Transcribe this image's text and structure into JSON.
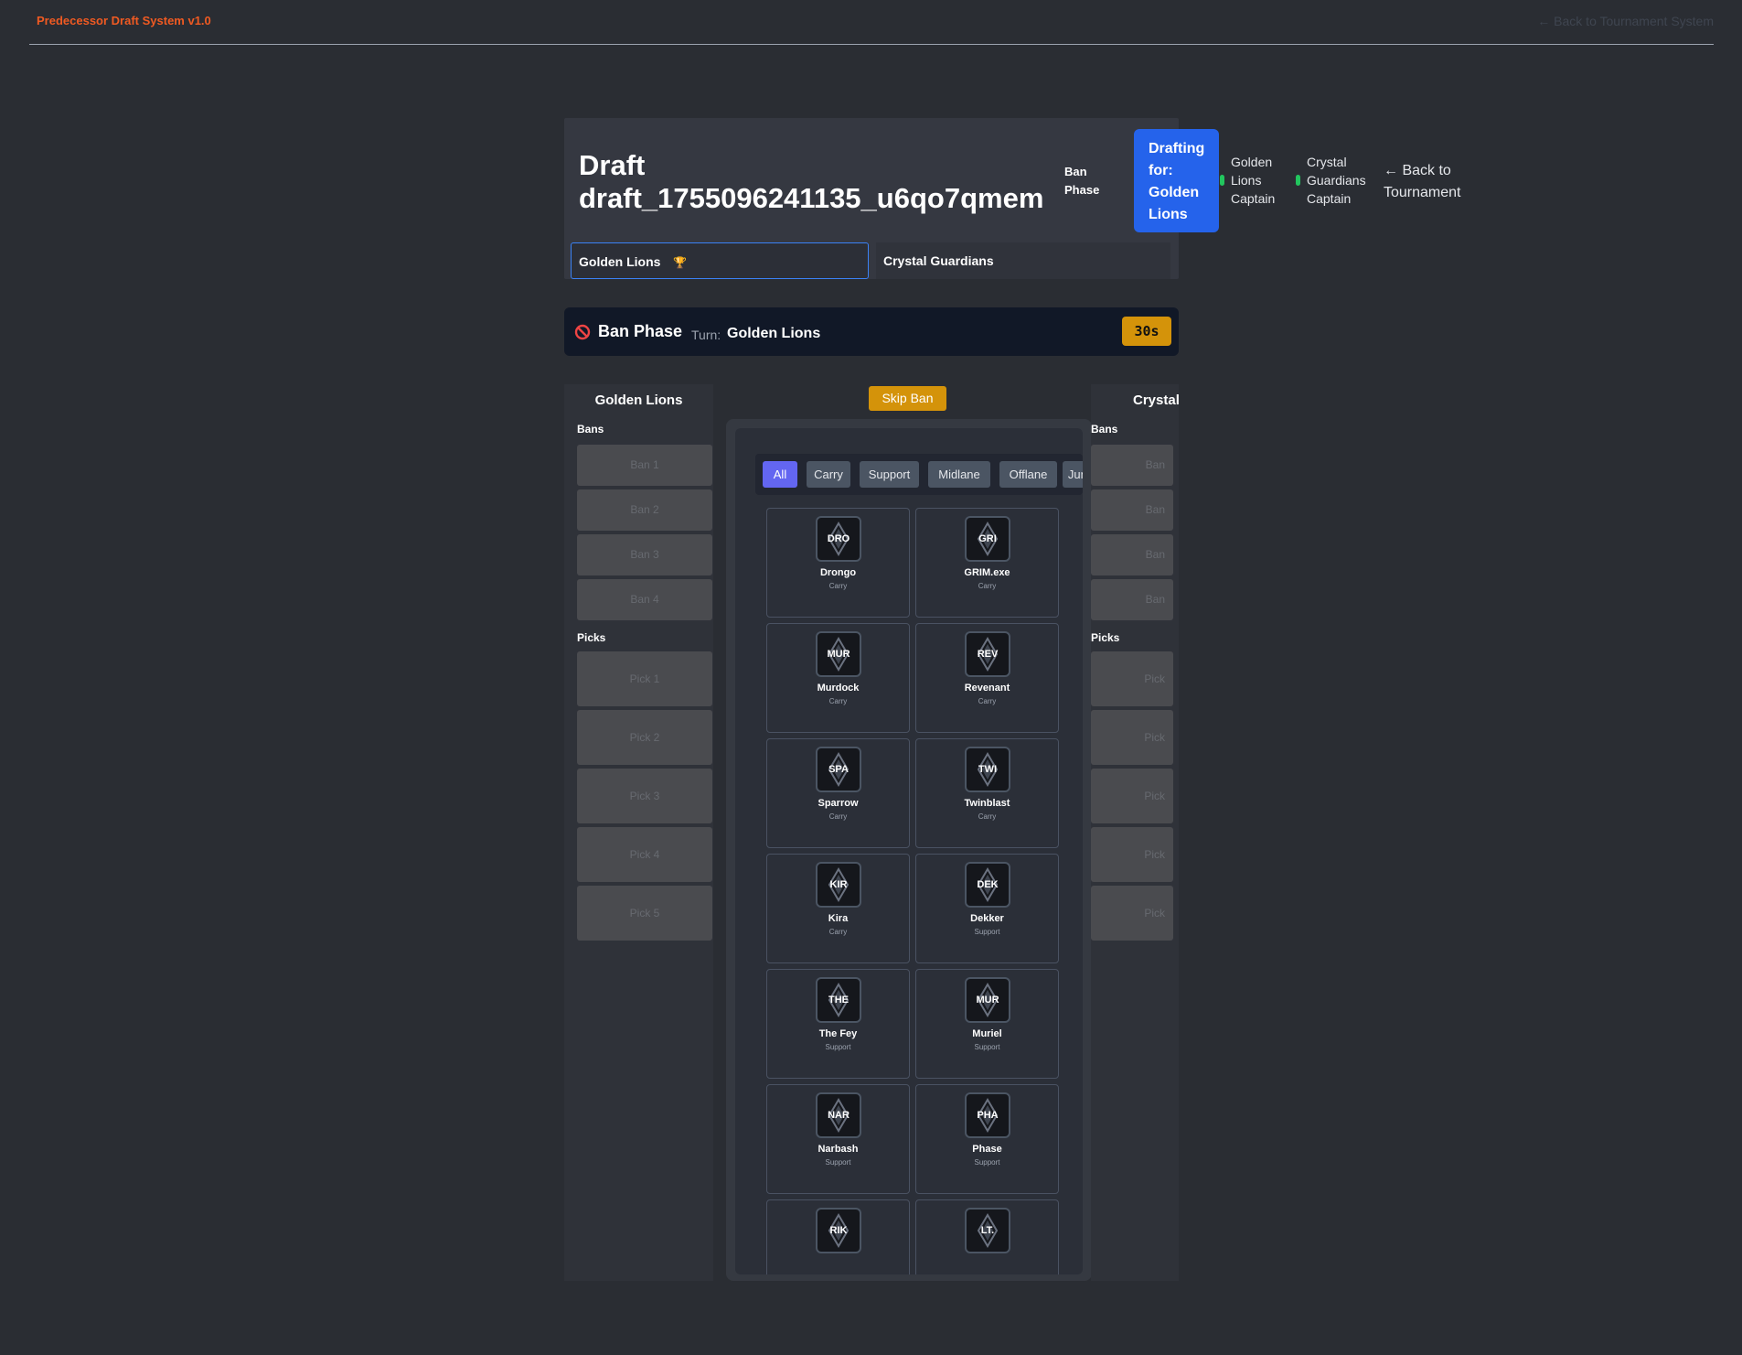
{
  "app": {
    "title": "Predecessor Draft System v1.0",
    "back_to_system": "← Back to Tournament System"
  },
  "header": {
    "draft_title": "Draft draft_1755096241135_u6qo7qmem",
    "phase": "Ban Phase",
    "drafting_for": "Drafting for: Golden Lions",
    "captains": [
      {
        "label": "Golden Lions Captain",
        "status_color": "#22c55e"
      },
      {
        "label": "Crystal Guardians Captain",
        "status_color": "#22c55e"
      }
    ],
    "back_to_tournament": "← Back to Tournament"
  },
  "team_tabs": [
    {
      "name": "Golden Lions",
      "icon": "trophy-icon",
      "icon_glyph": "🏆",
      "active": true
    },
    {
      "name": "Crystal Guardians",
      "active": false
    }
  ],
  "phase_bar": {
    "icon": "ban-icon",
    "title": "Ban Phase",
    "turn_label": "Turn:",
    "turn_team": "Golden Lions",
    "timer": "30s"
  },
  "board": {
    "skip_ban": "Skip Ban",
    "left_team": {
      "name": "Golden Lions",
      "bans_label": "Bans",
      "picks_label": "Picks",
      "bans": [
        "Ban 1",
        "Ban 2",
        "Ban 3",
        "Ban 4"
      ],
      "picks": [
        "Pick 1",
        "Pick 2",
        "Pick 3",
        "Pick 4",
        "Pick 5"
      ]
    },
    "right_team": {
      "name": "Crystal Gu",
      "bans_label": "Bans",
      "picks_label": "Picks",
      "bans": [
        "Ban",
        "Ban",
        "Ban",
        "Ban"
      ],
      "picks": [
        "Pick",
        "Pick",
        "Pick",
        "Pick",
        "Pick"
      ]
    },
    "filters": [
      {
        "label": "All",
        "active": true
      },
      {
        "label": "Carry",
        "active": false
      },
      {
        "label": "Support",
        "active": false
      },
      {
        "label": "Midlane",
        "active": false
      },
      {
        "label": "Offlane",
        "active": false
      },
      {
        "label": "Jung",
        "active": false
      }
    ],
    "heroes": [
      {
        "abbr": "DRO",
        "name": "Drongo",
        "role": "Carry"
      },
      {
        "abbr": "GRI",
        "name": "GRIM.exe",
        "role": "Carry"
      },
      {
        "abbr": "MUR",
        "name": "Murdock",
        "role": "Carry"
      },
      {
        "abbr": "REV",
        "name": "Revenant",
        "role": "Carry"
      },
      {
        "abbr": "SPA",
        "name": "Sparrow",
        "role": "Carry"
      },
      {
        "abbr": "TWI",
        "name": "Twinblast",
        "role": "Carry"
      },
      {
        "abbr": "KIR",
        "name": "Kira",
        "role": "Carry"
      },
      {
        "abbr": "DEK",
        "name": "Dekker",
        "role": "Support"
      },
      {
        "abbr": "THE",
        "name": "The Fey",
        "role": "Support"
      },
      {
        "abbr": "MUR",
        "name": "Muriel",
        "role": "Support"
      },
      {
        "abbr": "NAR",
        "name": "Narbash",
        "role": "Support"
      },
      {
        "abbr": "PHA",
        "name": "Phase",
        "role": "Support"
      },
      {
        "abbr": "RIK",
        "name": "",
        "role": ""
      },
      {
        "abbr": "LT.",
        "name": "",
        "role": ""
      }
    ]
  }
}
